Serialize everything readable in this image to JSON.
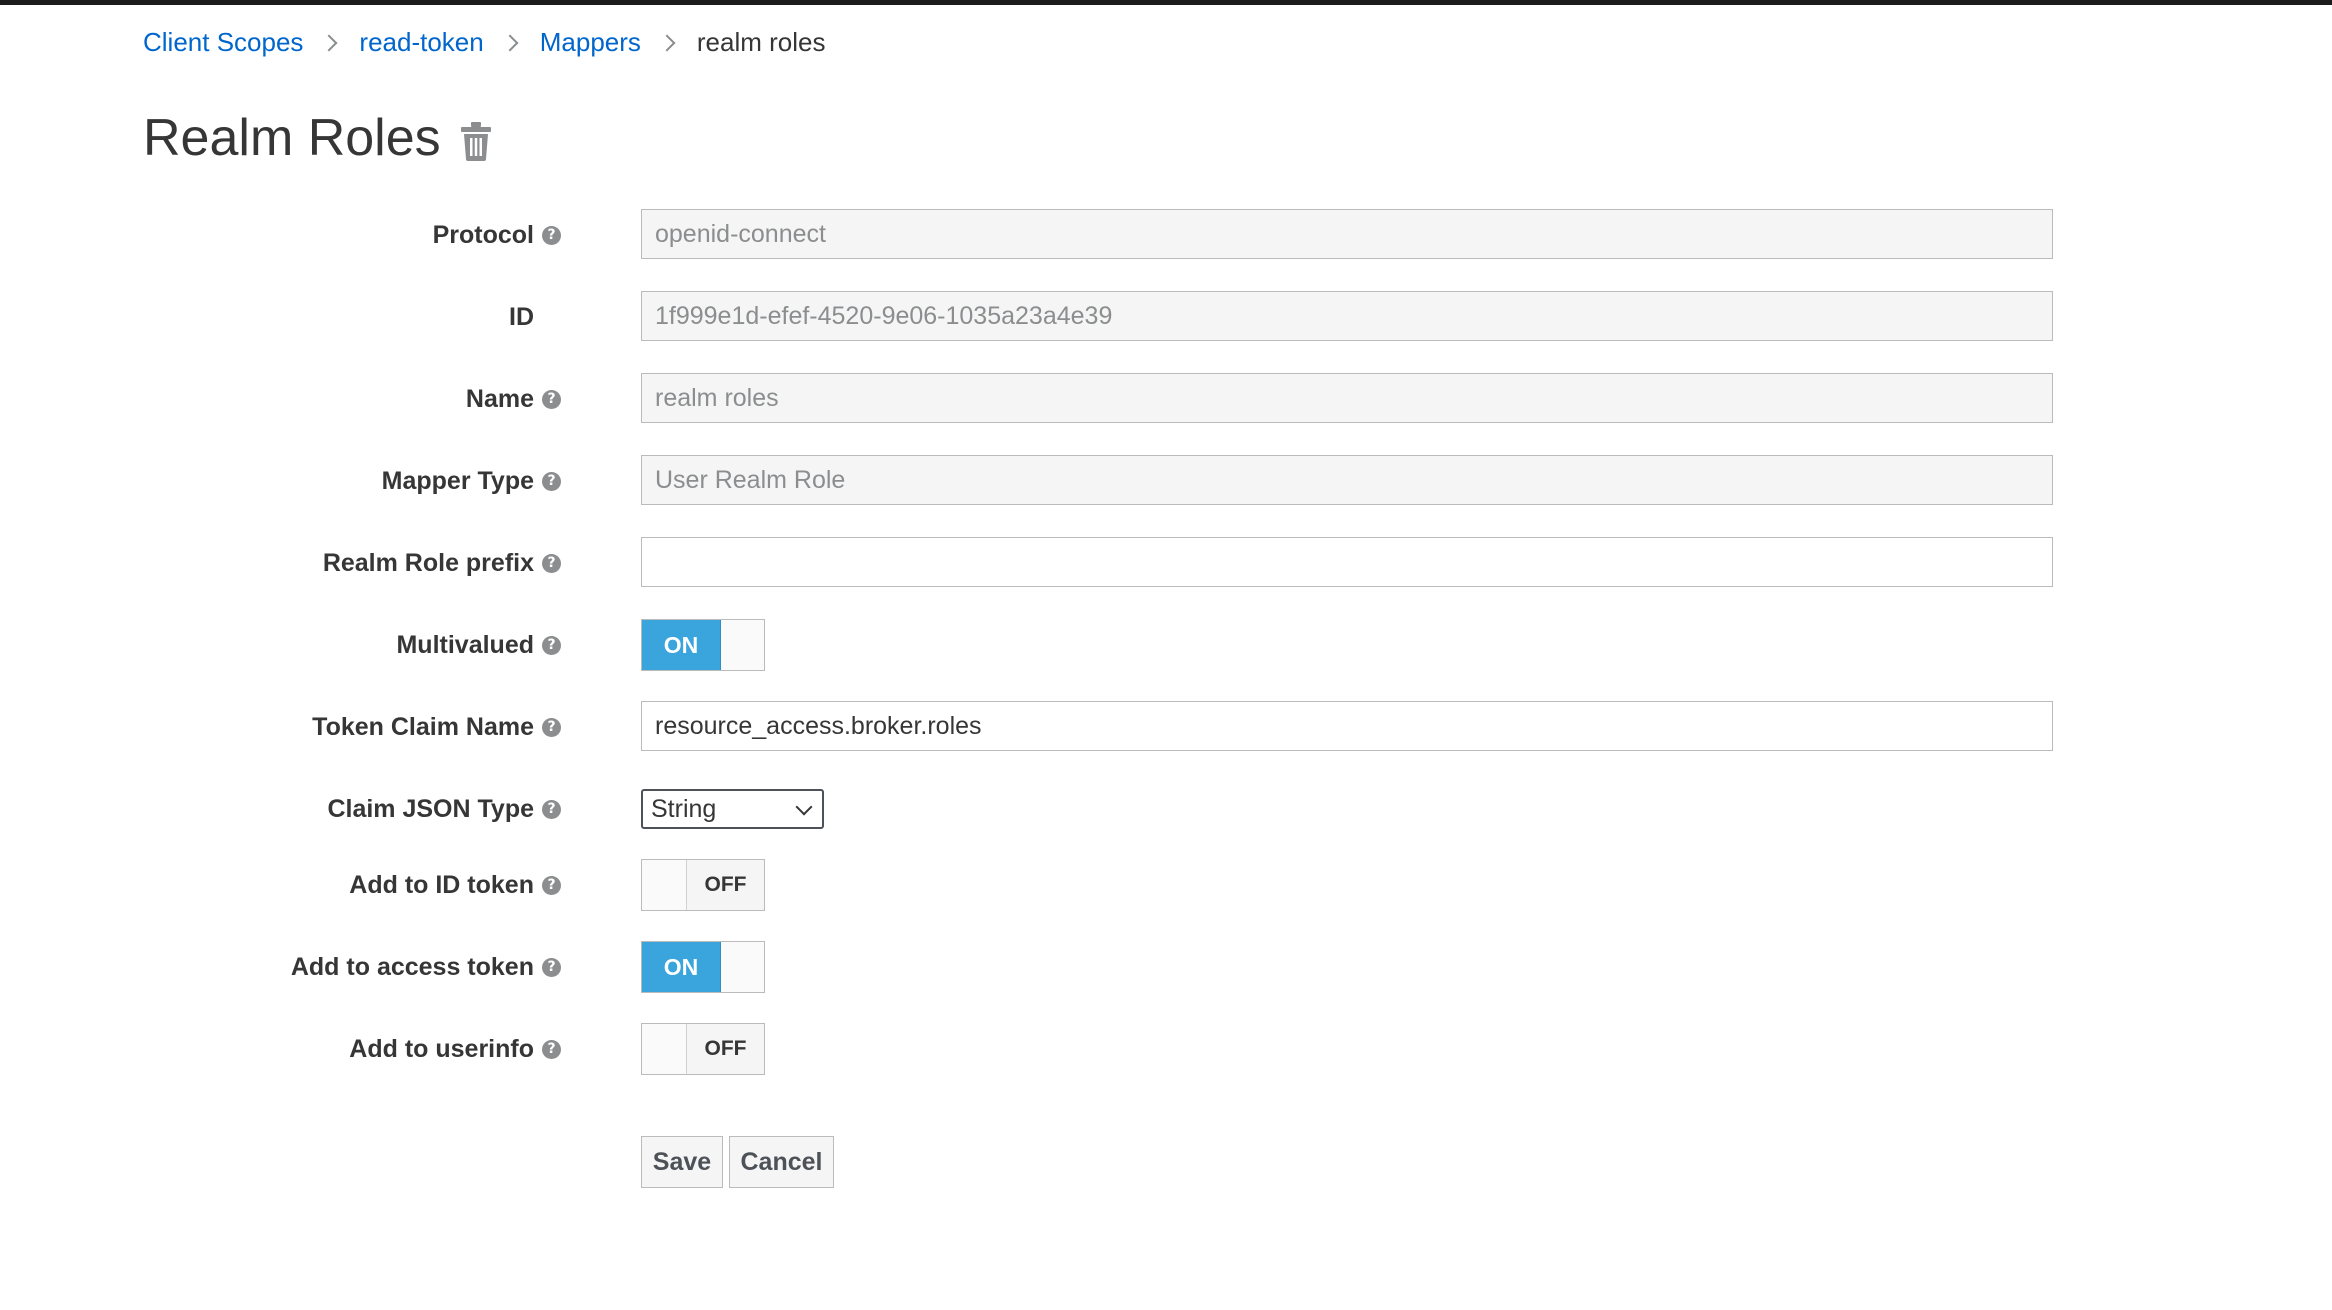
{
  "breadcrumb": {
    "items": [
      "Client Scopes",
      "read-token",
      "Mappers"
    ],
    "current": "realm roles"
  },
  "page": {
    "title": "Realm Roles",
    "delete_icon": "trash-icon"
  },
  "form": {
    "protocol": {
      "label": "Protocol",
      "value": "openid-connect",
      "readonly": true
    },
    "id": {
      "label": "ID",
      "value": "1f999e1d-efef-4520-9e06-1035a23a4e39",
      "readonly": true
    },
    "name": {
      "label": "Name",
      "value": "realm roles",
      "readonly": true
    },
    "mapper_type": {
      "label": "Mapper Type",
      "value": "User Realm Role",
      "readonly": true
    },
    "realm_role_prefix": {
      "label": "Realm Role prefix",
      "value": ""
    },
    "multivalued": {
      "label": "Multivalued",
      "state": "ON"
    },
    "token_claim_name": {
      "label": "Token Claim Name",
      "value": "resource_access.broker.roles"
    },
    "claim_json_type": {
      "label": "Claim JSON Type",
      "value": "String"
    },
    "add_to_id_token": {
      "label": "Add to ID token",
      "state": "OFF"
    },
    "add_to_access_token": {
      "label": "Add to access token",
      "state": "ON"
    },
    "add_to_userinfo": {
      "label": "Add to userinfo",
      "state": "OFF"
    }
  },
  "actions": {
    "save": "Save",
    "cancel": "Cancel"
  },
  "colors": {
    "link": "#0066cc",
    "toggle_on": "#39a5dc",
    "readonly_bg": "#f5f5f5",
    "help_icon": "#8b8d8f"
  }
}
